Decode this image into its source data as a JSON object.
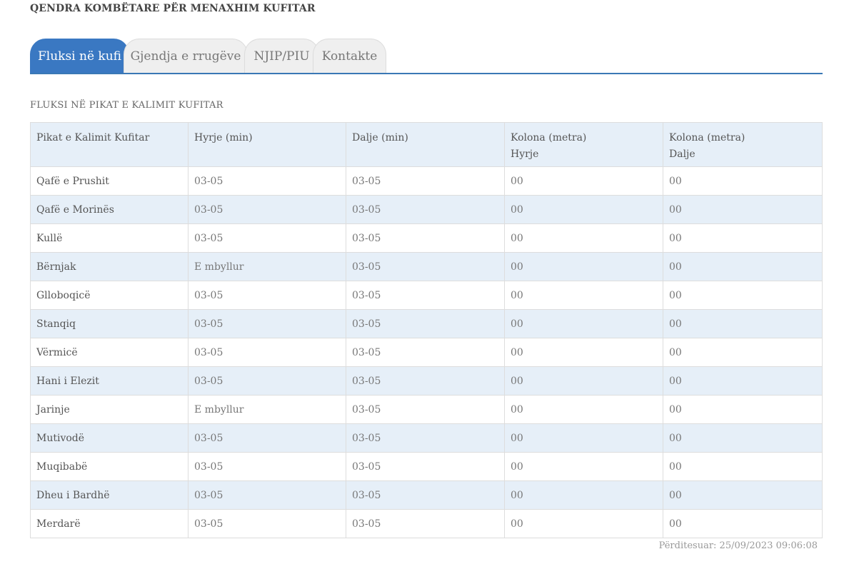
{
  "header": {
    "org_title": "QENDRA KOMBËTARE PËR MENAXHIM KUFITAR"
  },
  "tabs": [
    {
      "label": "Fluksi në kufi",
      "active": true
    },
    {
      "label": "Gjendja e rrugëve",
      "active": false
    },
    {
      "label": "NJIP/PIU",
      "active": false
    },
    {
      "label": "Kontakte",
      "active": false
    }
  ],
  "section": {
    "title": "FLUKSI NË PIKAT E KALIMIT KUFITAR"
  },
  "table": {
    "columns": [
      {
        "line1": "Pikat e Kalimit Kufitar",
        "line2": ""
      },
      {
        "line1": "Hyrje (min)",
        "line2": ""
      },
      {
        "line1": "Dalje (min)",
        "line2": ""
      },
      {
        "line1": "Kolona (metra)",
        "line2": "Hyrje"
      },
      {
        "line1": "Kolona (metra)",
        "line2": "Dalje"
      }
    ],
    "rows": [
      [
        "Qafë e Prushit",
        "03-05",
        "03-05",
        "00",
        "00"
      ],
      [
        "Qafë e Morinës",
        "03-05",
        "03-05",
        "00",
        "00"
      ],
      [
        "Kullë",
        "03-05",
        "03-05",
        "00",
        "00"
      ],
      [
        "Bërnjak",
        "E mbyllur",
        "03-05",
        "00",
        "00"
      ],
      [
        "Glloboqicë",
        "03-05",
        "03-05",
        "00",
        "00"
      ],
      [
        "Stanqiq",
        "03-05",
        "03-05",
        "00",
        "00"
      ],
      [
        "Vërmicë",
        "03-05",
        "03-05",
        "00",
        "00"
      ],
      [
        "Hani i Elezit",
        "03-05",
        "03-05",
        "00",
        "00"
      ],
      [
        "Jarinje",
        "E mbyllur",
        "03-05",
        "00",
        "00"
      ],
      [
        "Mutivodë",
        "03-05",
        "03-05",
        "00",
        "00"
      ],
      [
        "Muqibabë",
        "03-05",
        "03-05",
        "00",
        "00"
      ],
      [
        "Dheu i Bardhë",
        "03-05",
        "03-05",
        "00",
        "00"
      ],
      [
        "Merdarë",
        "03-05",
        "03-05",
        "00",
        "00"
      ]
    ]
  },
  "footer": {
    "updated": "Përditesuar: 25/09/2023 09:06:08"
  },
  "colors": {
    "accent": "#3a78c2",
    "row_alt": "#e6eff8",
    "border": "#dddddd"
  }
}
